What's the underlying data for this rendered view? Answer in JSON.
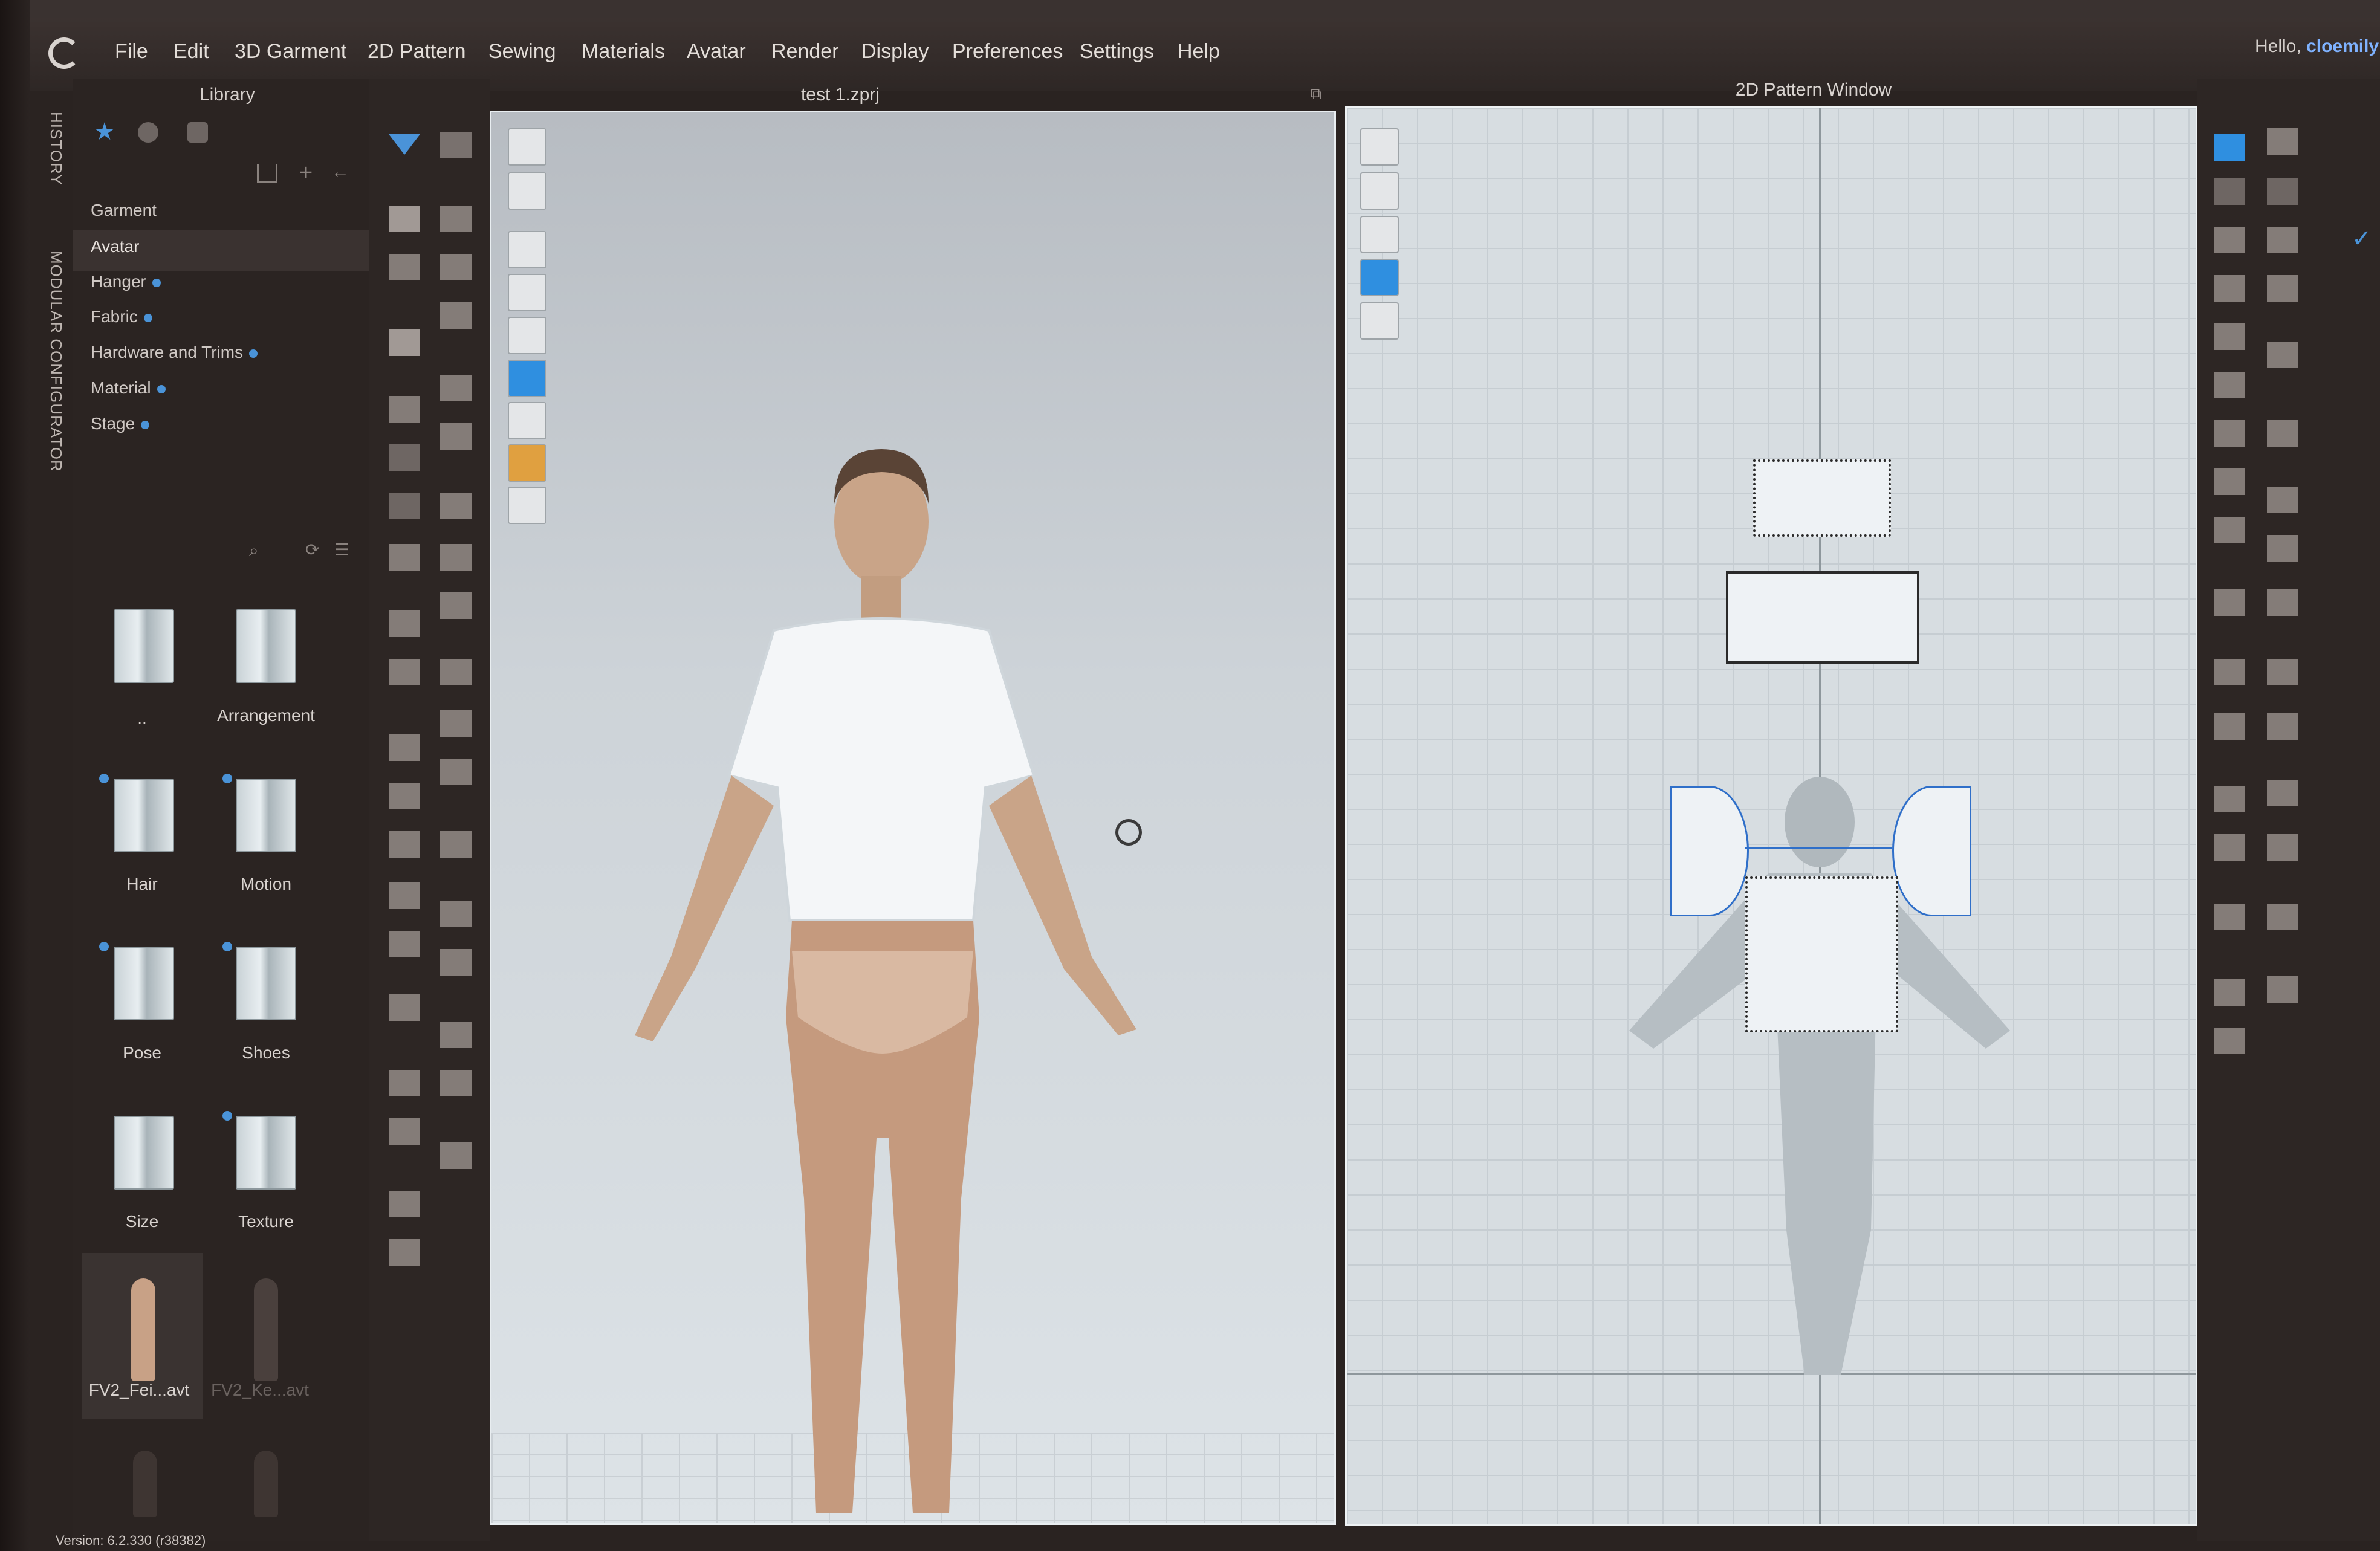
{
  "menu": [
    "File",
    "Edit",
    "3D Garment",
    "2D Pattern",
    "Sewing",
    "Materials",
    "Avatar",
    "Render",
    "Display",
    "Preferences",
    "Settings",
    "Help"
  ],
  "greeting": {
    "prefix": "Hello, ",
    "user": "cloemily"
  },
  "side_tabs": {
    "history": "HISTORY",
    "modular": "MODULAR CONFIGURATOR"
  },
  "library": {
    "title": "Library",
    "items": [
      "Garment",
      "Avatar",
      "Hanger",
      "Fabric",
      "Hardware and Trims",
      "Material",
      "Stage"
    ],
    "selected": "Avatar",
    "folders": [
      "..",
      "Arrangement",
      "Hair",
      "Motion",
      "Pose",
      "Shoes",
      "Size",
      "Texture"
    ],
    "avatars": [
      "FV2_Fei...avt",
      "FV2_Ke...avt"
    ]
  },
  "view3d": {
    "title": "test 1.zprj"
  },
  "view2d": {
    "title": "2D Pattern Window"
  },
  "status": {
    "version": "Version:  6.2.330 (r38382)"
  },
  "colors": {
    "accent": "#4a93d8",
    "panel": "#2b2422",
    "viewport3d": "#cdd3d8",
    "pattern_bg": "#d7dde1"
  }
}
